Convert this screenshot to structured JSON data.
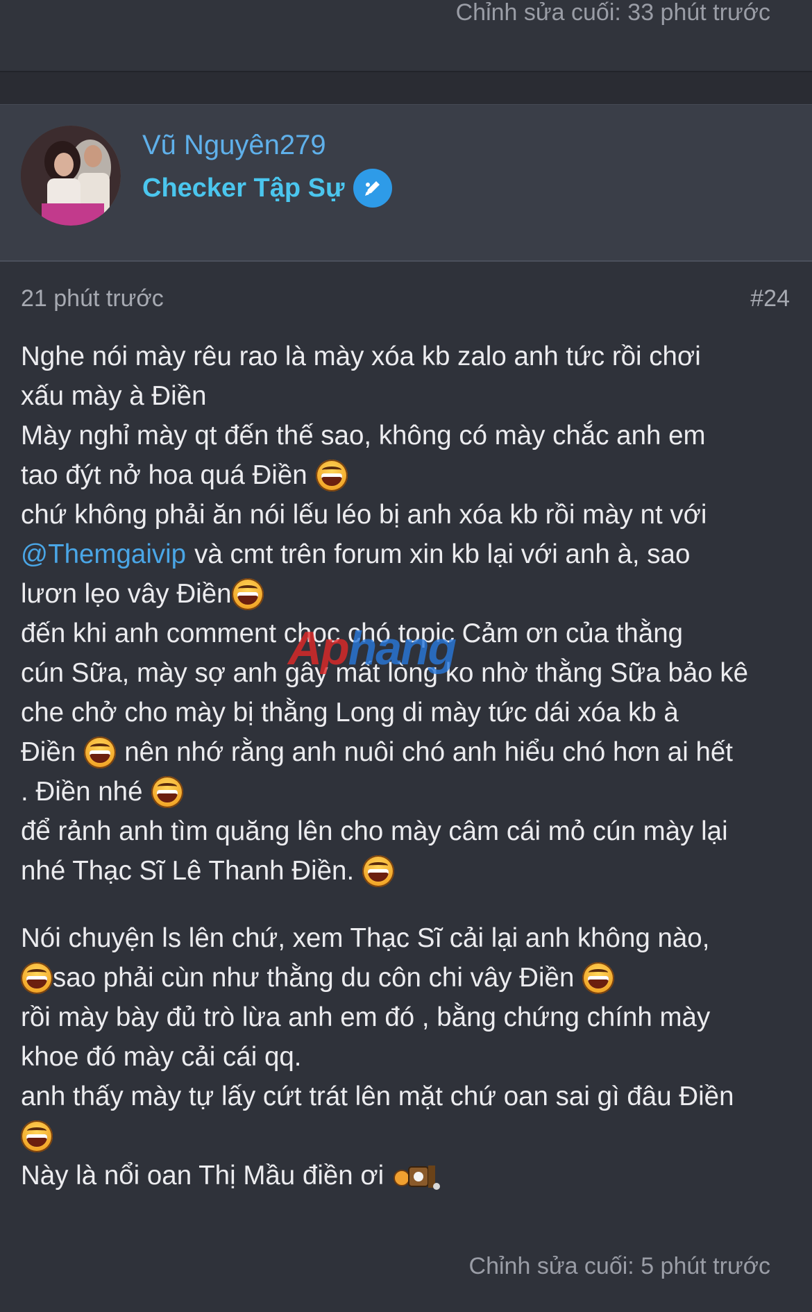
{
  "previous_post": {
    "last_edit": "Chỉnh sửa cuối: 33 phút trước"
  },
  "user": {
    "name": "Vũ Nguyên279",
    "title": "Checker Tập Sự",
    "badge_icon": "pencil-badge-icon"
  },
  "post": {
    "time": "21 phút trước",
    "number": "#24",
    "lines": [
      "Nghe nói mày rêu rao là mày xóa kb zalo anh tức rồi chơi",
      "xấu mày à Điền",
      "Mày nghỉ mày qt đến thế sao, không có mày chắc anh em",
      "tao đýt nở hoa quá Điền",
      "chứ không phải ăn nói lếu léo bị anh xóa kb rồi mày nt với",
      "@Themgaivip",
      "và cmt trên forum xin kb lại với anh à, sao",
      "lươn lẹo vây Điền",
      "đến khi anh comment chọc chó topic Cảm ơn của thằng",
      "cún Sữa, mày sợ anh gây mất lòng ko nhờ thằng Sữa bảo kê",
      "che chở cho mày bị thằng Long di mày tức dái xóa kb à",
      "Điền",
      "nên nhớ rằng anh nuôi chó anh hiểu chó hơn ai hết",
      ". Điền nhé",
      "để rảnh anh tìm quăng lên cho mày câm cái mỏ cún mày lại",
      "nhé Thạc Sĩ Lê Thanh Điền.",
      "Nói chuyện ls lên chứ, xem Thạc Sĩ cải lại anh không nào,",
      "sao phải cùn như thằng du côn chi vây Điền",
      "rồi mày bày đủ trò lừa anh em đó , bằng chứng chính mày",
      "khoe đó mày cải cái qq.",
      "anh thấy mày tự lấy cứt trát lên mặt chứ oan sai gì đâu Điền",
      "Này là nổi oan Thị Mầu điền ơi"
    ],
    "emoji_icon": "laughing-emoji-icon",
    "watermark": {
      "part1": "Ap",
      "part2": "hang"
    },
    "last_edit": "Chỉnh sửa cuối: 5 phút trước"
  },
  "colors": {
    "background": "#2f323a",
    "user_block": "#3a3e48",
    "username": "#5fb0ea",
    "user_title": "#4bc6ee",
    "mention": "#4aa6e6",
    "meta_text": "#a7aab2"
  }
}
